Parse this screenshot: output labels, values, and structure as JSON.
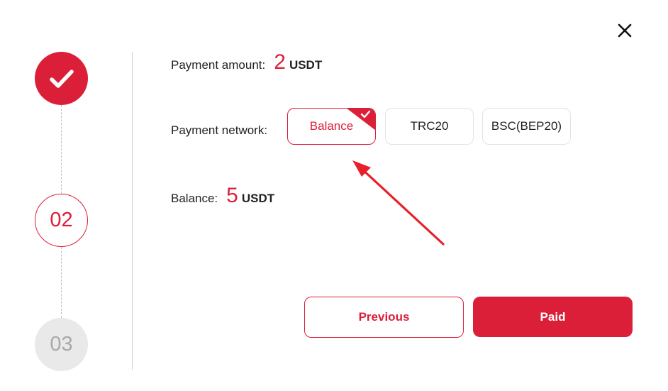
{
  "colors": {
    "accent": "#dc1f38",
    "pending_step_bg": "#e9e9e9",
    "pending_step_text": "#a9a9a9"
  },
  "steps": [
    {
      "label": "",
      "state": "completed",
      "icon": "check-icon"
    },
    {
      "label": "02",
      "state": "active"
    },
    {
      "label": "03",
      "state": "pending"
    }
  ],
  "payment": {
    "amount_label": "Payment amount:",
    "amount_value": "2",
    "amount_unit": "USDT",
    "network_label": "Payment network:",
    "networks": [
      {
        "label": "Balance",
        "selected": true
      },
      {
        "label": "TRC20",
        "selected": false
      },
      {
        "label": "BSC(BEP20)",
        "selected": false
      }
    ],
    "balance_label": "Balance:",
    "balance_value": "5",
    "balance_unit": "USDT"
  },
  "actions": {
    "previous_label": "Previous",
    "paid_label": "Paid"
  },
  "icons": {
    "close": "close-icon",
    "selected_corner": "check-icon",
    "annotation": "arrow-annotation"
  }
}
